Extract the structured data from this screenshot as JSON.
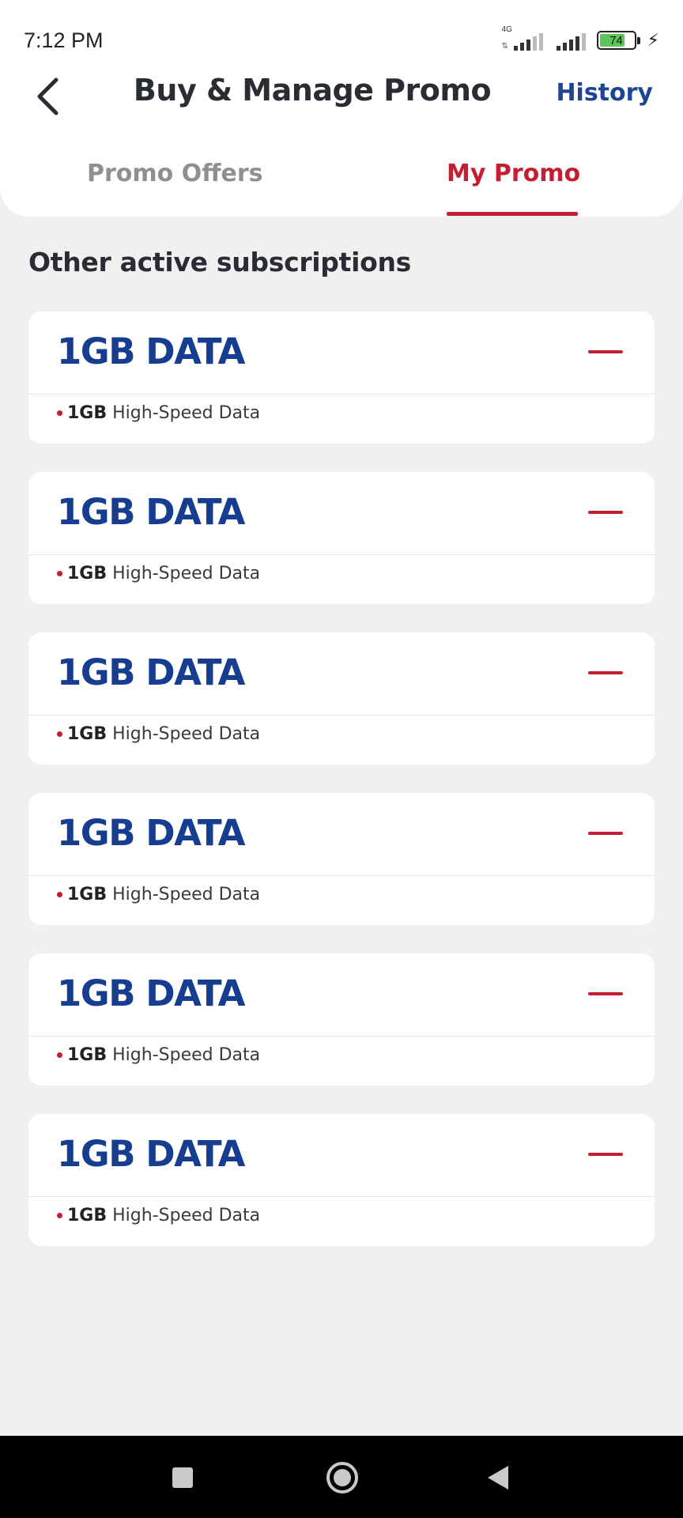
{
  "status_bar": {
    "time": "7:12 PM",
    "network": "4G",
    "battery": "74",
    "battery_level_pct": 74,
    "icons": [
      "signal-icon",
      "signal-icon",
      "battery-icon",
      "charging-icon"
    ]
  },
  "header": {
    "title": "Buy & Manage Promo",
    "action": "History",
    "back_icon": "back-arrow-icon"
  },
  "tabs": [
    {
      "label": "Promo Offers",
      "active": false
    },
    {
      "label": "My Promo",
      "active": true
    }
  ],
  "section_title": "Other active subscriptions",
  "subscriptions": [
    {
      "title": "1GB DATA",
      "amount": "1GB",
      "description": "High-Speed Data"
    },
    {
      "title": "1GB DATA",
      "amount": "1GB",
      "description": "High-Speed Data"
    },
    {
      "title": "1GB DATA",
      "amount": "1GB",
      "description": "High-Speed Data"
    },
    {
      "title": "1GB DATA",
      "amount": "1GB",
      "description": "High-Speed Data"
    },
    {
      "title": "1GB DATA",
      "amount": "1GB",
      "description": "High-Speed Data"
    },
    {
      "title": "1GB DATA",
      "amount": "1GB",
      "description": "High-Speed Data"
    }
  ],
  "colors": {
    "brand_red": "#c41e32",
    "brand_blue": "#1d4596",
    "background": "#f0f0f0"
  },
  "nav_bar": {
    "icons": [
      "recents-icon",
      "home-icon",
      "back-icon"
    ]
  }
}
